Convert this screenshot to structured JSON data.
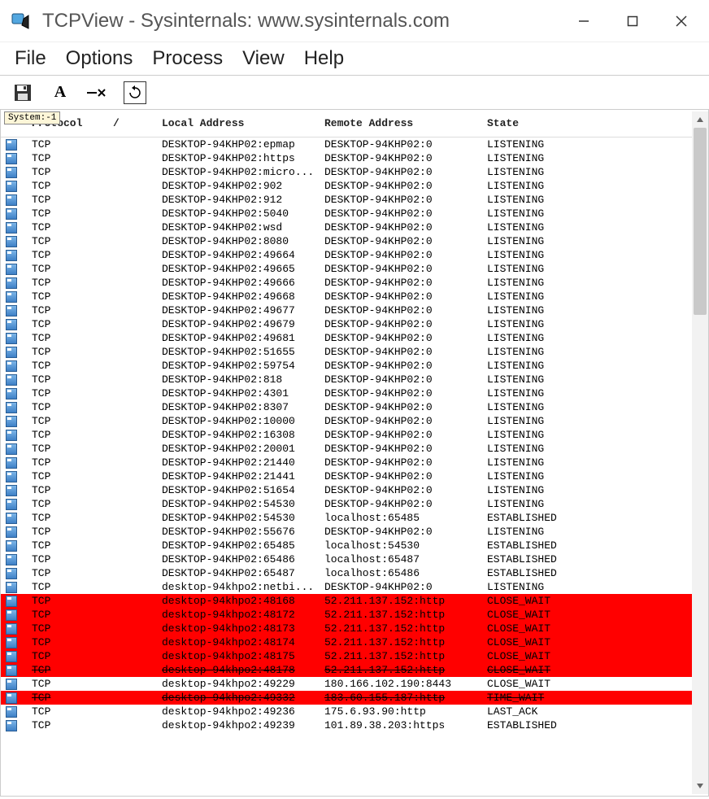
{
  "window": {
    "title": "TCPView - Sysinternals: www.sysinternals.com"
  },
  "menubar": {
    "items": [
      "File",
      "Options",
      "Process",
      "View",
      "Help"
    ]
  },
  "floating_label": "System:-1",
  "columns": {
    "protocol": "Protocol",
    "slash": "/",
    "local": "Local Address",
    "remote": "Remote Address",
    "state": "State"
  },
  "rows": [
    {
      "proto": "TCP",
      "local": "DESKTOP-94KHP02:epmap",
      "remote": "DESKTOP-94KHP02:0",
      "state": "LISTENING",
      "hl": ""
    },
    {
      "proto": "TCP",
      "local": "DESKTOP-94KHP02:https",
      "remote": "DESKTOP-94KHP02:0",
      "state": "LISTENING",
      "hl": ""
    },
    {
      "proto": "TCP",
      "local": "DESKTOP-94KHP02:micro...",
      "remote": "DESKTOP-94KHP02:0",
      "state": "LISTENING",
      "hl": ""
    },
    {
      "proto": "TCP",
      "local": "DESKTOP-94KHP02:902",
      "remote": "DESKTOP-94KHP02:0",
      "state": "LISTENING",
      "hl": ""
    },
    {
      "proto": "TCP",
      "local": "DESKTOP-94KHP02:912",
      "remote": "DESKTOP-94KHP02:0",
      "state": "LISTENING",
      "hl": ""
    },
    {
      "proto": "TCP",
      "local": "DESKTOP-94KHP02:5040",
      "remote": "DESKTOP-94KHP02:0",
      "state": "LISTENING",
      "hl": ""
    },
    {
      "proto": "TCP",
      "local": "DESKTOP-94KHP02:wsd",
      "remote": "DESKTOP-94KHP02:0",
      "state": "LISTENING",
      "hl": ""
    },
    {
      "proto": "TCP",
      "local": "DESKTOP-94KHP02:8080",
      "remote": "DESKTOP-94KHP02:0",
      "state": "LISTENING",
      "hl": ""
    },
    {
      "proto": "TCP",
      "local": "DESKTOP-94KHP02:49664",
      "remote": "DESKTOP-94KHP02:0",
      "state": "LISTENING",
      "hl": ""
    },
    {
      "proto": "TCP",
      "local": "DESKTOP-94KHP02:49665",
      "remote": "DESKTOP-94KHP02:0",
      "state": "LISTENING",
      "hl": ""
    },
    {
      "proto": "TCP",
      "local": "DESKTOP-94KHP02:49666",
      "remote": "DESKTOP-94KHP02:0",
      "state": "LISTENING",
      "hl": ""
    },
    {
      "proto": "TCP",
      "local": "DESKTOP-94KHP02:49668",
      "remote": "DESKTOP-94KHP02:0",
      "state": "LISTENING",
      "hl": ""
    },
    {
      "proto": "TCP",
      "local": "DESKTOP-94KHP02:49677",
      "remote": "DESKTOP-94KHP02:0",
      "state": "LISTENING",
      "hl": ""
    },
    {
      "proto": "TCP",
      "local": "DESKTOP-94KHP02:49679",
      "remote": "DESKTOP-94KHP02:0",
      "state": "LISTENING",
      "hl": ""
    },
    {
      "proto": "TCP",
      "local": "DESKTOP-94KHP02:49681",
      "remote": "DESKTOP-94KHP02:0",
      "state": "LISTENING",
      "hl": ""
    },
    {
      "proto": "TCP",
      "local": "DESKTOP-94KHP02:51655",
      "remote": "DESKTOP-94KHP02:0",
      "state": "LISTENING",
      "hl": ""
    },
    {
      "proto": "TCP",
      "local": "DESKTOP-94KHP02:59754",
      "remote": "DESKTOP-94KHP02:0",
      "state": "LISTENING",
      "hl": ""
    },
    {
      "proto": "TCP",
      "local": "DESKTOP-94KHP02:818",
      "remote": "DESKTOP-94KHP02:0",
      "state": "LISTENING",
      "hl": ""
    },
    {
      "proto": "TCP",
      "local": "DESKTOP-94KHP02:4301",
      "remote": "DESKTOP-94KHP02:0",
      "state": "LISTENING",
      "hl": ""
    },
    {
      "proto": "TCP",
      "local": "DESKTOP-94KHP02:8307",
      "remote": "DESKTOP-94KHP02:0",
      "state": "LISTENING",
      "hl": ""
    },
    {
      "proto": "TCP",
      "local": "DESKTOP-94KHP02:10000",
      "remote": "DESKTOP-94KHP02:0",
      "state": "LISTENING",
      "hl": ""
    },
    {
      "proto": "TCP",
      "local": "DESKTOP-94KHP02:16308",
      "remote": "DESKTOP-94KHP02:0",
      "state": "LISTENING",
      "hl": ""
    },
    {
      "proto": "TCP",
      "local": "DESKTOP-94KHP02:20001",
      "remote": "DESKTOP-94KHP02:0",
      "state": "LISTENING",
      "hl": ""
    },
    {
      "proto": "TCP",
      "local": "DESKTOP-94KHP02:21440",
      "remote": "DESKTOP-94KHP02:0",
      "state": "LISTENING",
      "hl": ""
    },
    {
      "proto": "TCP",
      "local": "DESKTOP-94KHP02:21441",
      "remote": "DESKTOP-94KHP02:0",
      "state": "LISTENING",
      "hl": ""
    },
    {
      "proto": "TCP",
      "local": "DESKTOP-94KHP02:51654",
      "remote": "DESKTOP-94KHP02:0",
      "state": "LISTENING",
      "hl": ""
    },
    {
      "proto": "TCP",
      "local": "DESKTOP-94KHP02:54530",
      "remote": "DESKTOP-94KHP02:0",
      "state": "LISTENING",
      "hl": ""
    },
    {
      "proto": "TCP",
      "local": "DESKTOP-94KHP02:54530",
      "remote": "localhost:65485",
      "state": "ESTABLISHED",
      "hl": ""
    },
    {
      "proto": "TCP",
      "local": "DESKTOP-94KHP02:55676",
      "remote": "DESKTOP-94KHP02:0",
      "state": "LISTENING",
      "hl": ""
    },
    {
      "proto": "TCP",
      "local": "DESKTOP-94KHP02:65485",
      "remote": "localhost:54530",
      "state": "ESTABLISHED",
      "hl": ""
    },
    {
      "proto": "TCP",
      "local": "DESKTOP-94KHP02:65486",
      "remote": "localhost:65487",
      "state": "ESTABLISHED",
      "hl": ""
    },
    {
      "proto": "TCP",
      "local": "DESKTOP-94KHP02:65487",
      "remote": "localhost:65486",
      "state": "ESTABLISHED",
      "hl": ""
    },
    {
      "proto": "TCP",
      "local": "desktop-94khpo2:netbi...",
      "remote": "DESKTOP-94KHP02:0",
      "state": "LISTENING",
      "hl": ""
    },
    {
      "proto": "TCP",
      "local": "desktop-94khpo2:48168",
      "remote": "52.211.137.152:http",
      "state": "CLOSE_WAIT",
      "hl": "red"
    },
    {
      "proto": "TCP",
      "local": "desktop-94khpo2:48172",
      "remote": "52.211.137.152:http",
      "state": "CLOSE_WAIT",
      "hl": "red"
    },
    {
      "proto": "TCP",
      "local": "desktop-94khpo2:48173",
      "remote": "52.211.137.152:http",
      "state": "CLOSE_WAIT",
      "hl": "red"
    },
    {
      "proto": "TCP",
      "local": "desktop-94khpo2:48174",
      "remote": "52.211.137.152:http",
      "state": "CLOSE_WAIT",
      "hl": "red"
    },
    {
      "proto": "TCP",
      "local": "desktop-94khpo2:48175",
      "remote": "52.211.137.152:http",
      "state": "CLOSE_WAIT",
      "hl": "red"
    },
    {
      "proto": "TCP",
      "local": "desktop-94khpo2:48178",
      "remote": "52.211.137.152:http",
      "state": "CLOSE_WAIT",
      "hl": "red strike"
    },
    {
      "proto": "TCP",
      "local": "desktop-94khpo2:49229",
      "remote": "180.166.102.190:8443",
      "state": "CLOSE_WAIT",
      "hl": ""
    },
    {
      "proto": "TCP",
      "local": "desktop-94khpo2:49332",
      "remote": "183.60.155.187:http",
      "state": "TIME_WAIT",
      "hl": "red strike"
    },
    {
      "proto": "TCP",
      "local": "desktop-94khpo2:49236",
      "remote": "175.6.93.90:http",
      "state": "LAST_ACK",
      "hl": ""
    },
    {
      "proto": "TCP",
      "local": "desktop-94khpo2:49239",
      "remote": "101.89.38.203:https",
      "state": "ESTABLISHED",
      "hl": ""
    }
  ]
}
